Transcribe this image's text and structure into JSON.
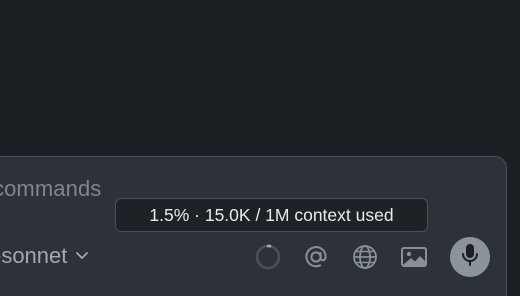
{
  "composer": {
    "prompt_text": "commands",
    "model_label": "-sonnet"
  },
  "context": {
    "tooltip_text": "1.5% · 15.0K / 1M context used",
    "percent_used": 1.5
  },
  "icons": {
    "context_ring": "context-usage-ring-icon",
    "mention": "at-icon",
    "web": "globe-icon",
    "image": "image-icon",
    "voice": "microphone-icon",
    "model_dropdown": "chevron-down-icon"
  },
  "colors": {
    "background": "#1b1e22",
    "composer_bg": "#2d3239",
    "composer_border": "#4a5059",
    "tooltip_bg": "#1e2227",
    "icon": "#8a9098",
    "mic_button": "#8d939b"
  }
}
